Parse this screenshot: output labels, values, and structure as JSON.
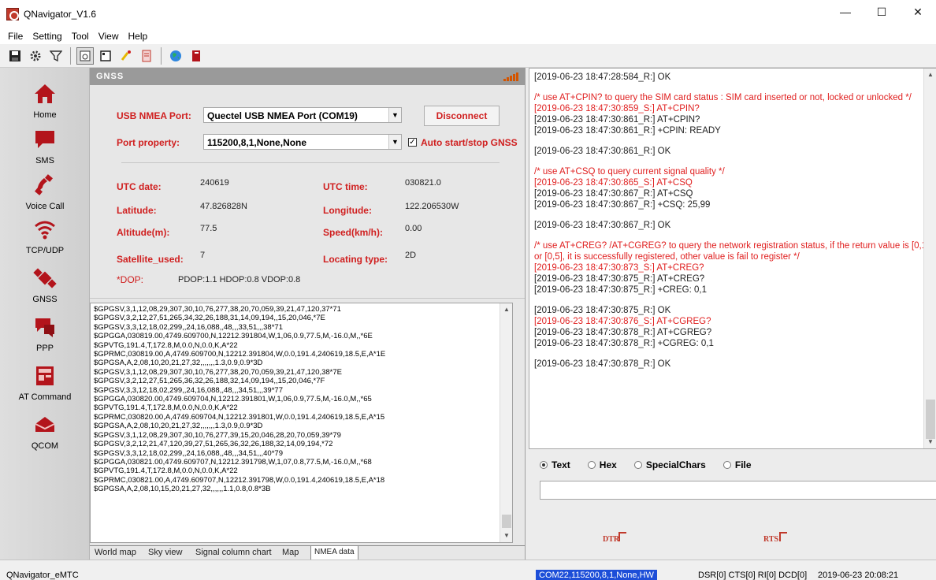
{
  "window": {
    "title": "QNavigator_V1.6",
    "controls": {
      "minimize": "—",
      "maximize": "☐",
      "close": "✕"
    }
  },
  "menu": [
    "File",
    "Setting",
    "Tool",
    "View",
    "Help"
  ],
  "toolbar": {
    "icons": [
      "save-icon",
      "settings-icon",
      "filter-icon",
      "view-icon",
      "calendar-icon",
      "brush-icon",
      "doc-icon",
      "globe-icon",
      "book-icon"
    ]
  },
  "nav": [
    {
      "label": "Home",
      "icon": "home-icon",
      "glyph": "🏠"
    },
    {
      "label": "SMS",
      "icon": "sms-icon",
      "glyph": "💬"
    },
    {
      "label": "Voice Call",
      "icon": "phone-icon",
      "glyph": "📞"
    },
    {
      "label": "TCP/UDP",
      "icon": "wifi-icon",
      "glyph": "📶"
    },
    {
      "label": "GNSS",
      "icon": "satellite-icon",
      "glyph": "🛰"
    },
    {
      "label": "PPP",
      "icon": "ppp-icon",
      "glyph": "💬"
    },
    {
      "label": "AT Command",
      "icon": "terminal-icon",
      "glyph": "🖥"
    },
    {
      "label": "QCOM",
      "icon": "qcom-icon",
      "glyph": "🛢"
    }
  ],
  "gnss": {
    "header": "GNSS",
    "usb_port_label": "USB NMEA Port:",
    "usb_port_value": "Quectel USB NMEA Port (COM19)",
    "disconnect_label": "Disconnect",
    "port_property_label": "Port property:",
    "port_property_value": "115200,8,1,None,None",
    "auto_label": "Auto start/stop GNSS",
    "auto_checked": true,
    "utc_date_label": "UTC date:",
    "utc_date": "240619",
    "utc_time_label": "UTC time:",
    "utc_time": "030821.0",
    "latitude_label": "Latitude:",
    "latitude": "47.826828N",
    "longitude_label": "Longitude:",
    "longitude": "122.206530W",
    "altitude_label": "Altitude(m):",
    "altitude": "77.5",
    "speed_label": "Speed(km/h):",
    "speed": "0.00",
    "sat_label": "Satellite_used:",
    "sat": "7",
    "locating_label": "Locating type:",
    "locating": "2D",
    "dop_label": "*DOP:",
    "dop": "PDOP:1.1  HDOP:0.8  VDOP:0.8",
    "nmea_lines": [
      "$GPGSV,3,1,12,08,29,307,30,10,76,277,38,20,70,059,39,21,47,120,37*71",
      "$GPGSV,3,2,12,27,51,265,34,32,26,188,31,14,09,194,,15,20,046,*7E",
      "$GPGSV,3,3,12,18,02,299,,24,16,088,,48,,,33,51,,,38*71",
      "$GPGGA,030819.00,4749.609700,N,12212.391804,W,1,06,0.9,77.5,M,-16.0,M,,*6E",
      "$GPVTG,191.4,T,172.8,M,0.0,N,0.0,K,A*22",
      "$GPRMC,030819.00,A,4749.609700,N,12212.391804,W,0.0,191.4,240619,18.5,E,A*1E",
      "$GPGSA,A,2,08,10,20,21,27,32,,,,,,,1.3,0.9,0.9*3D",
      "$GPGSV,3,1,12,08,29,307,30,10,76,277,38,20,70,059,39,21,47,120,38*7E",
      "$GPGSV,3,2,12,27,51,265,36,32,26,188,32,14,09,194,,15,20,046,*7F",
      "$GPGSV,3,3,12,18,02,299,,24,16,088,,48,,,34,51,,,39*77",
      "$GPGGA,030820.00,4749.609704,N,12212.391801,W,1,06,0.9,77.5,M,-16.0,M,,*65",
      "$GPVTG,191.4,T,172.8,M,0.0,N,0.0,K,A*22",
      "$GPRMC,030820.00,A,4749.609704,N,12212.391801,W,0.0,191.4,240619,18.5,E,A*15",
      "$GPGSA,A,2,08,10,20,21,27,32,,,,,,,1.3,0.9,0.9*3D",
      "$GPGSV,3,1,12,08,29,307,30,10,76,277,39,15,20,046,28,20,70,059,39*79",
      "$GPGSV,3,2,12,21,47,120,39,27,51,265,36,32,26,188,32,14,09,194,*72",
      "$GPGSV,3,3,12,18,02,299,,24,16,088,,48,,,34,51,,,40*79",
      "$GPGGA,030821.00,4749.609707,N,12212.391798,W,1,07,0.8,77.5,M,-16.0,M,,*68",
      "$GPVTG,191.4,T,172.8,M,0.0,N,0.0,K,A*22",
      "$GPRMC,030821.00,A,4749.609707,N,12212.391798,W,0.0,191.4,240619,18.5,E,A*18",
      "$GPGSA,A,2,08,10,15,20,21,27,32,,,,,,1.1,0.8,0.8*3B"
    ],
    "tabs": [
      "World map",
      "Sky view",
      "Signal column chart",
      "Map",
      "NMEA data"
    ],
    "active_tab": "NMEA data"
  },
  "log": {
    "lines": [
      {
        "t": "[2019-06-23 18:47:28:584_R:] OK",
        "c": "black"
      },
      {
        "t": "",
        "c": "gap"
      },
      {
        "t": "/* use AT+CPIN? to query the SIM card status : SIM card inserted or not, locked or unlocked */",
        "c": "red"
      },
      {
        "t": "[2019-06-23 18:47:30:859_S:] AT+CPIN?",
        "c": "red"
      },
      {
        "t": "[2019-06-23 18:47:30:861_R:] AT+CPIN?",
        "c": "black"
      },
      {
        "t": "[2019-06-23 18:47:30:861_R:] +CPIN: READY",
        "c": "black"
      },
      {
        "t": "",
        "c": "gap"
      },
      {
        "t": "[2019-06-23 18:47:30:861_R:] OK",
        "c": "black"
      },
      {
        "t": "",
        "c": "gap"
      },
      {
        "t": "/* use AT+CSQ to query current signal quality */",
        "c": "red"
      },
      {
        "t": "[2019-06-23 18:47:30:865_S:] AT+CSQ",
        "c": "red"
      },
      {
        "t": "[2019-06-23 18:47:30:867_R:] AT+CSQ",
        "c": "black"
      },
      {
        "t": "[2019-06-23 18:47:30:867_R:] +CSQ: 25,99",
        "c": "black"
      },
      {
        "t": "",
        "c": "gap"
      },
      {
        "t": "[2019-06-23 18:47:30:867_R:] OK",
        "c": "black"
      },
      {
        "t": "",
        "c": "gap"
      },
      {
        "t": "/* use AT+CREG? /AT+CGREG? to query the network registration status, if the return value is [0,1] or [0,5], it is successfully registered, other value is fail to register */",
        "c": "red"
      },
      {
        "t": "[2019-06-23 18:47:30:873_S:] AT+CREG?",
        "c": "red"
      },
      {
        "t": "[2019-06-23 18:47:30:875_R:] AT+CREG?",
        "c": "black"
      },
      {
        "t": "[2019-06-23 18:47:30:875_R:] +CREG: 0,1",
        "c": "black"
      },
      {
        "t": "",
        "c": "gap"
      },
      {
        "t": "[2019-06-23 18:47:30:875_R:] OK",
        "c": "black"
      },
      {
        "t": "[2019-06-23 18:47:30:876_S:] AT+CGREG?",
        "c": "red"
      },
      {
        "t": "[2019-06-23 18:47:30:878_R:] AT+CGREG?",
        "c": "black"
      },
      {
        "t": "[2019-06-23 18:47:30:878_R:] +CGREG: 0,1",
        "c": "black"
      },
      {
        "t": "",
        "c": "gap"
      },
      {
        "t": "[2019-06-23 18:47:30:878_R:] OK",
        "c": "black"
      }
    ],
    "modes": [
      "Text",
      "Hex",
      "SpecialChars",
      "File"
    ],
    "selected_mode": "Text",
    "dtr_label": "DTR",
    "rts_label": "RTS"
  },
  "status": {
    "app": "QNavigator_eMTC",
    "port": "COM22,115200,8,1,None,HW",
    "lines": "DSR[0] CTS[0] RI[0] DCD[0]",
    "time": "2019-06-23 20:08:21"
  },
  "colors": {
    "accent_red": "#d02020",
    "status_blue": "#1d4ed8",
    "icon_red": "#b3141b"
  }
}
